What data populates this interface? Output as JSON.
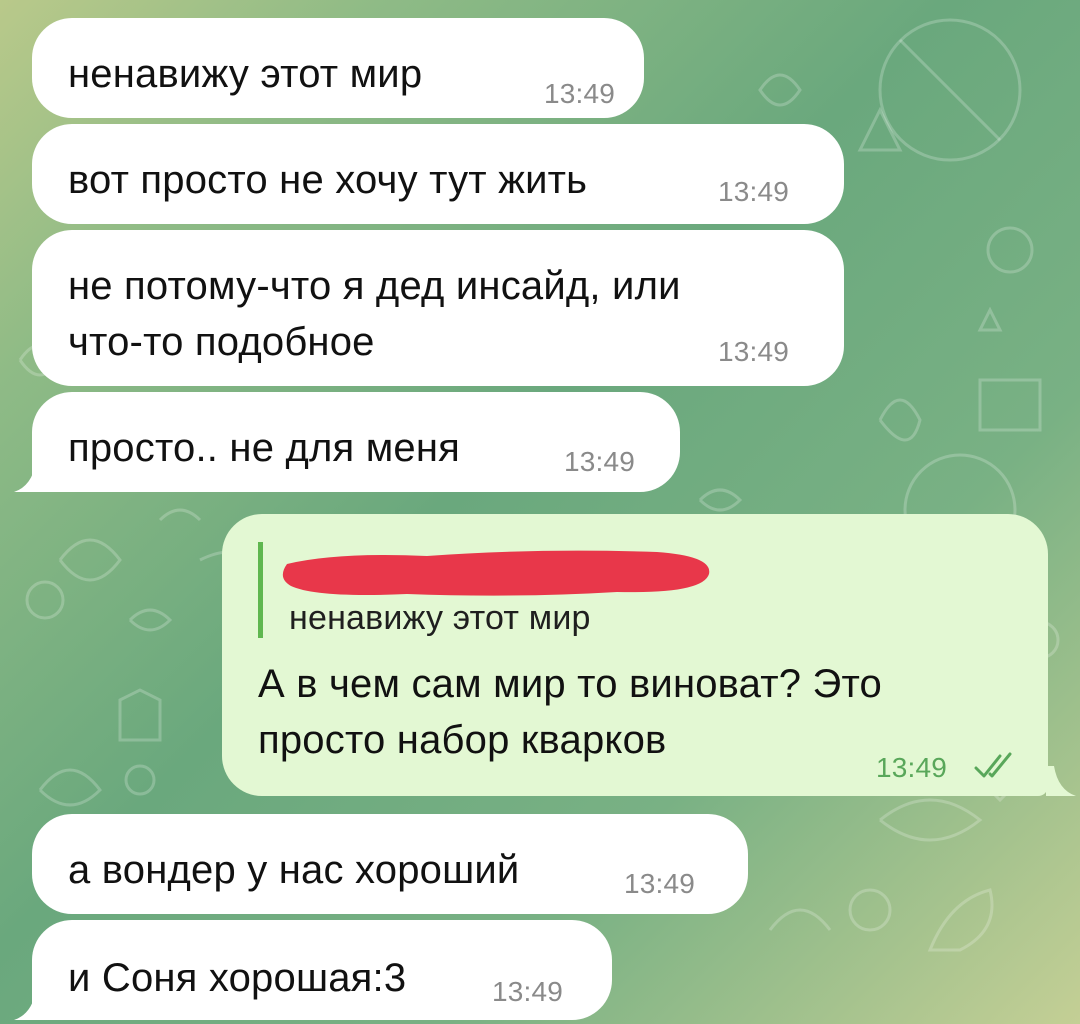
{
  "messages": {
    "m1": {
      "text": "ненавижу этот мир",
      "time": "13:49"
    },
    "m2": {
      "text": "вот просто не хочу тут жить",
      "time": "13:49"
    },
    "m3": {
      "line1": "не потому-что я дед инсайд, или",
      "line2": "что-то подобное",
      "time": "13:49"
    },
    "m4": {
      "text": "просто.. не для меня",
      "time": "13:49"
    },
    "m5": {
      "reply_quote": "ненавижу этот мир",
      "line1": "А в чем сам мир то виноват? Это",
      "line2": "просто набор кварков",
      "time": "13:49",
      "status": "read"
    },
    "m6": {
      "text": "а вондер у нас хороший",
      "time": "13:49"
    },
    "m7": {
      "text": "и Соня хорошая:3",
      "time": "13:49"
    }
  },
  "colors": {
    "incoming_bubble": "#ffffff",
    "outgoing_bubble": "#e3f8d3",
    "accent_green": "#59a75a",
    "redaction": "#e8374a"
  }
}
